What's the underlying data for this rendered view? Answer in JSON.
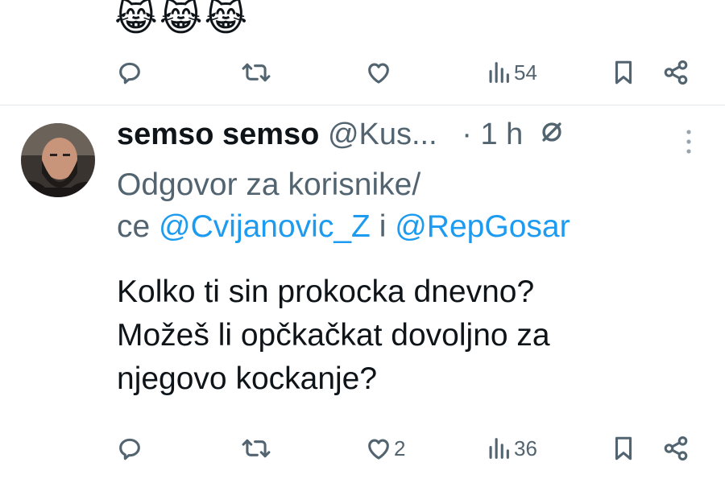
{
  "previous_tweet": {
    "emojis": "😹😹😹",
    "views": "54"
  },
  "tweet": {
    "display_name": "semso semso",
    "handle": "@Kus...",
    "separator": "·",
    "time": "1 h",
    "reply_prefix": "Odgovor za korisnike/",
    "reply_prefix2": "ce ",
    "mention1": "@Cvijanovic_Z",
    "mention_joiner": " i ",
    "mention2": "@RepGosar",
    "text_lines": [
      "Kolko ti sin prokocka dnevno?",
      "Možeš li opčkačkat dovoljno za",
      "njegovo kockanje?"
    ],
    "likes": "2",
    "views": "36"
  },
  "colors": {
    "text": "#0f1419",
    "secondary": "#536471",
    "link": "#1d9bf0",
    "divider": "#e1e6ea"
  },
  "icons": [
    "reply-icon",
    "retweet-icon",
    "like-icon",
    "views-icon",
    "bookmark-icon",
    "share-icon",
    "more-icon",
    "mute-icon"
  ]
}
